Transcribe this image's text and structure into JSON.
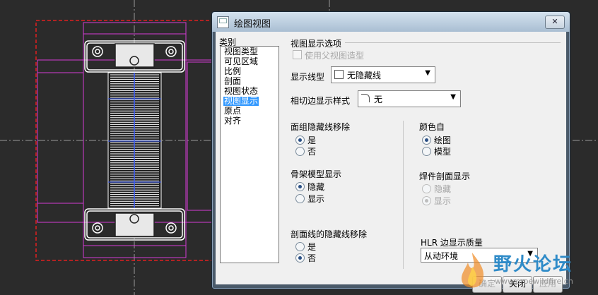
{
  "dialog": {
    "title": "绘图视图",
    "close_label": "✕",
    "category_label": "类别",
    "categories": [
      "视图类型",
      "可见区域",
      "比例",
      "剖面",
      "视图状态",
      "视图显示",
      "原点",
      "对齐"
    ],
    "selected_category": "视图显示"
  },
  "options": {
    "group_title": "视图显示选项",
    "use_parent_style": "使用父视图造型",
    "display_line_style_label": "显示线型",
    "display_line_style_value": "无隐藏线",
    "tangent_edge_label": "相切边显示样式",
    "tangent_edge_value": "无",
    "face_group_label": "面组隐藏线移除",
    "face_group_yes": "是",
    "face_group_no": "否",
    "color_from_label": "颜色自",
    "color_from_drawing": "绘图",
    "color_from_model": "模型",
    "skeleton_label": "骨架模型显示",
    "skeleton_hide": "隐藏",
    "skeleton_show": "显示",
    "weld_section_label": "焊件剖面显示",
    "weld_hide": "隐藏",
    "weld_show": "显示",
    "section_line_label": "剖面线的隐藏线移除",
    "section_yes": "是",
    "section_no": "否",
    "hlr_label": "HLR 边显示质量",
    "hlr_value": "从动环境"
  },
  "buttons": {
    "ok": "确定",
    "close": "关闭",
    "apply": "应用"
  },
  "watermark": {
    "main": "野火论坛",
    "sub": "www.proewildfire.cn"
  },
  "colors": {
    "canvas": "#2b2b2b",
    "magenta": "#d43bd4",
    "red_dashed": "#e02020",
    "blue": "#3a5cff",
    "selection": "#3399ff"
  }
}
